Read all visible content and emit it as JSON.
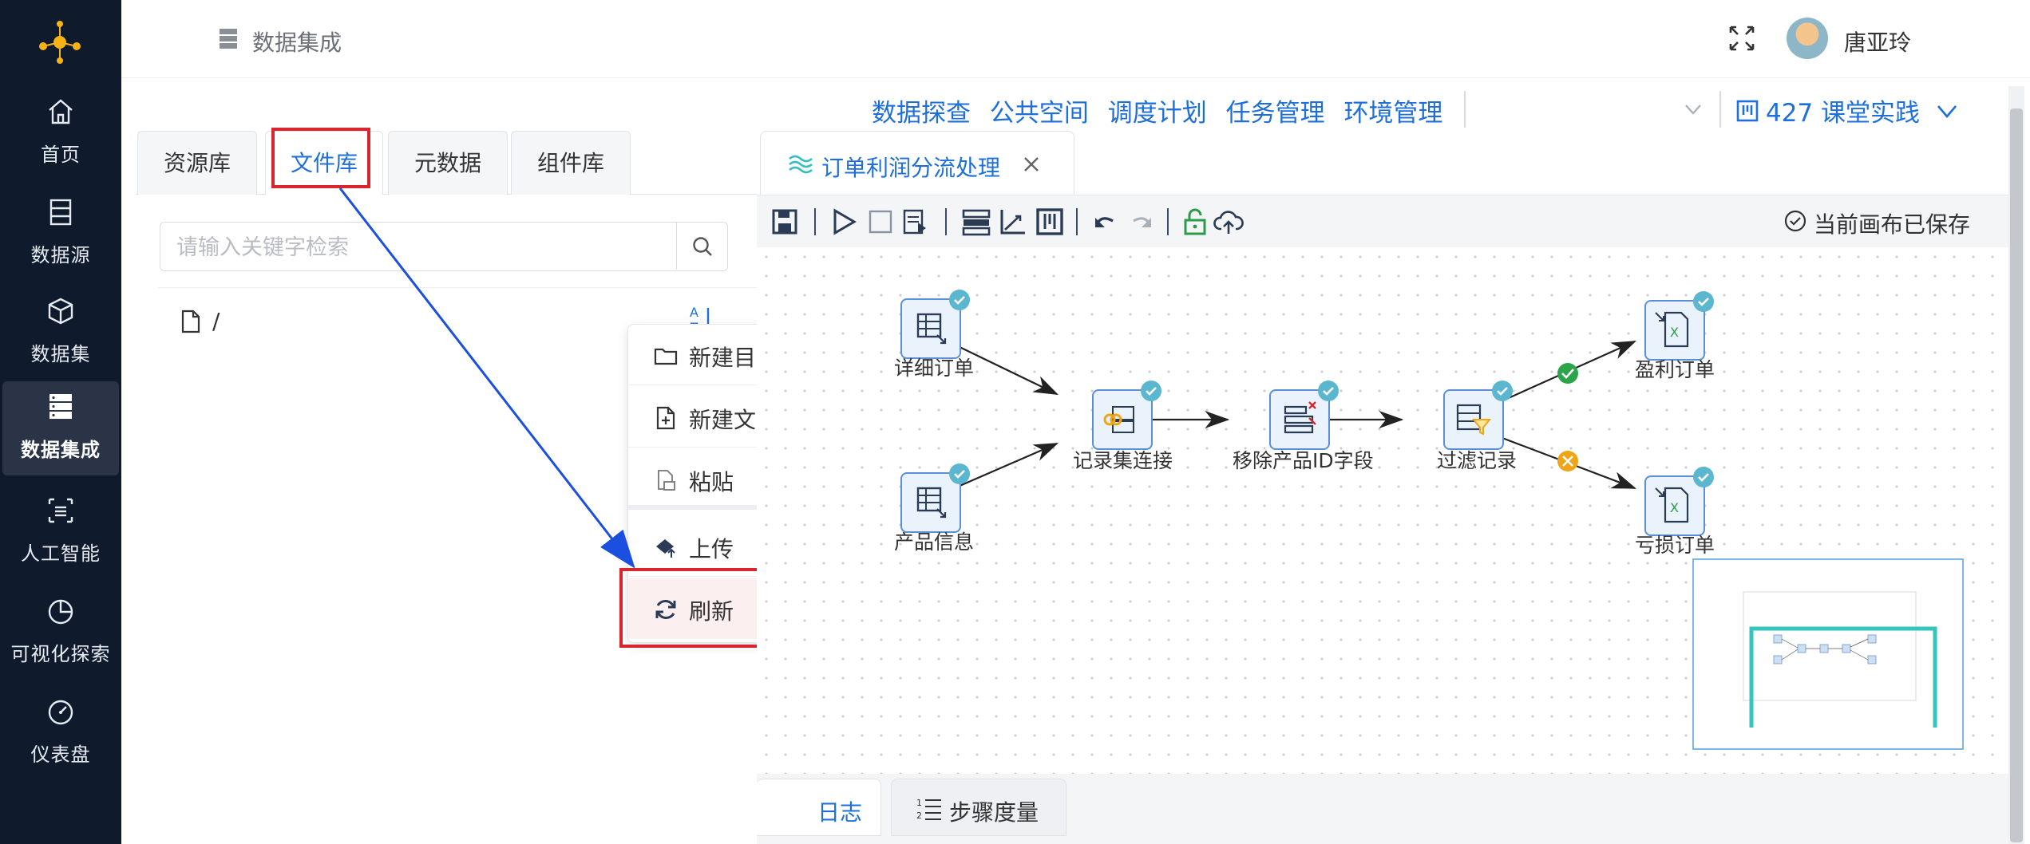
{
  "sidebar": {
    "items": [
      {
        "label": "首页",
        "icon": "home-icon"
      },
      {
        "label": "数据源",
        "icon": "database-icon"
      },
      {
        "label": "数据集",
        "icon": "cube-icon"
      },
      {
        "label": "数据集成",
        "icon": "server-icon",
        "active": true
      },
      {
        "label": "人工智能",
        "icon": "ai-scan-icon"
      },
      {
        "label": "可视化探索",
        "icon": "pie-chart-icon"
      },
      {
        "label": "仪表盘",
        "icon": "dashboard-gauge-icon"
      }
    ]
  },
  "header": {
    "breadcrumb": "数据集成",
    "user_name": "唐亚玲"
  },
  "top_menu": {
    "items": [
      "数据探查",
      "公共空间",
      "调度计划",
      "任务管理",
      "环境管理"
    ],
    "project": "427 课堂实践"
  },
  "left_panel": {
    "tabs": [
      "资源库",
      "文件库",
      "元数据",
      "组件库"
    ],
    "active_tab": "文件库",
    "search_placeholder": "请输入关键字检索",
    "tree_root": "/"
  },
  "context_menu": {
    "items": [
      {
        "label": "新建目录",
        "icon": "folder-icon"
      },
      {
        "label": "新建文件",
        "icon": "new-file-icon"
      },
      {
        "label": "粘贴",
        "icon": "paste-icon"
      },
      {
        "label": "上传",
        "icon": "upload-icon"
      },
      {
        "label": "刷新",
        "icon": "refresh-icon"
      }
    ],
    "highlighted": "刷新"
  },
  "workspace": {
    "tab_title": "订单利润分流处理",
    "saved_status": "当前画布已保存"
  },
  "canvas": {
    "nodes": [
      {
        "id": "detail",
        "label": "详细订单",
        "icon": "table-input-icon"
      },
      {
        "id": "product",
        "label": "产品信息",
        "icon": "table-input-icon"
      },
      {
        "id": "join",
        "label": "记录集连接",
        "icon": "join-icon"
      },
      {
        "id": "remove",
        "label": "移除产品ID字段",
        "icon": "remove-field-icon"
      },
      {
        "id": "filter",
        "label": "过滤记录",
        "icon": "filter-icon"
      },
      {
        "id": "profit",
        "label": "盈利订单",
        "icon": "excel-output-icon"
      },
      {
        "id": "loss",
        "label": "亏损订单",
        "icon": "excel-output-icon"
      }
    ]
  },
  "bottom_tabs": [
    "日志",
    "步骤度量"
  ],
  "colors": {
    "accent": "#1e6fd9",
    "sidebar_bg": "#0f1a2c",
    "highlight_red": "#d7262e",
    "arrow_blue": "#1a4fe0"
  }
}
